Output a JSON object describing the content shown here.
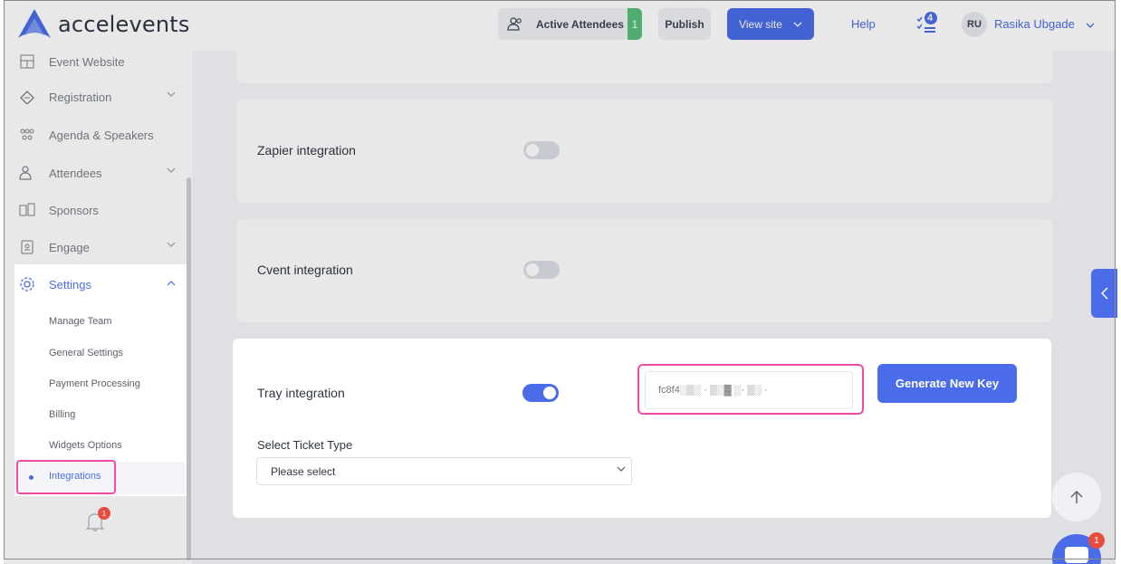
{
  "header": {
    "brand": "accelevents",
    "active_attendees_label": "Active Attendees",
    "active_attendees_count": "1",
    "publish_label": "Publish",
    "view_site_label": "View site",
    "help_label": "Help",
    "tasks_count": "4",
    "user_initials": "RU",
    "user_name": "Rasika Ubgade"
  },
  "sidebar": {
    "items": [
      {
        "label": "Event Website",
        "icon": "layout-icon"
      },
      {
        "label": "Registration",
        "icon": "ticket-icon"
      },
      {
        "label": "Agenda & Speakers",
        "icon": "people-icon"
      },
      {
        "label": "Attendees",
        "icon": "users-icon"
      },
      {
        "label": "Sponsors",
        "icon": "sponsor-icon"
      },
      {
        "label": "Engage",
        "icon": "badge-icon"
      }
    ],
    "settings_label": "Settings",
    "settings_sub": [
      "Manage Team",
      "General Settings",
      "Payment Processing",
      "Billing",
      "Widgets Options",
      "Integrations"
    ],
    "bell_count": "1"
  },
  "main": {
    "zapier_label": "Zapier integration",
    "cvent_label": "Cvent integration",
    "tray_label": "Tray integration",
    "tray_key": "fc8f4░▒░ · ▒░▓ ░· ▒░ ·",
    "generate_label": "Generate New Key",
    "ticket_type_label": "Select Ticket Type",
    "ticket_type_value": "Please select",
    "chat_badge": "1"
  },
  "colors": {
    "accent": "#4a6ce8",
    "highlight": "#f04ba5",
    "success": "#57c07a"
  }
}
